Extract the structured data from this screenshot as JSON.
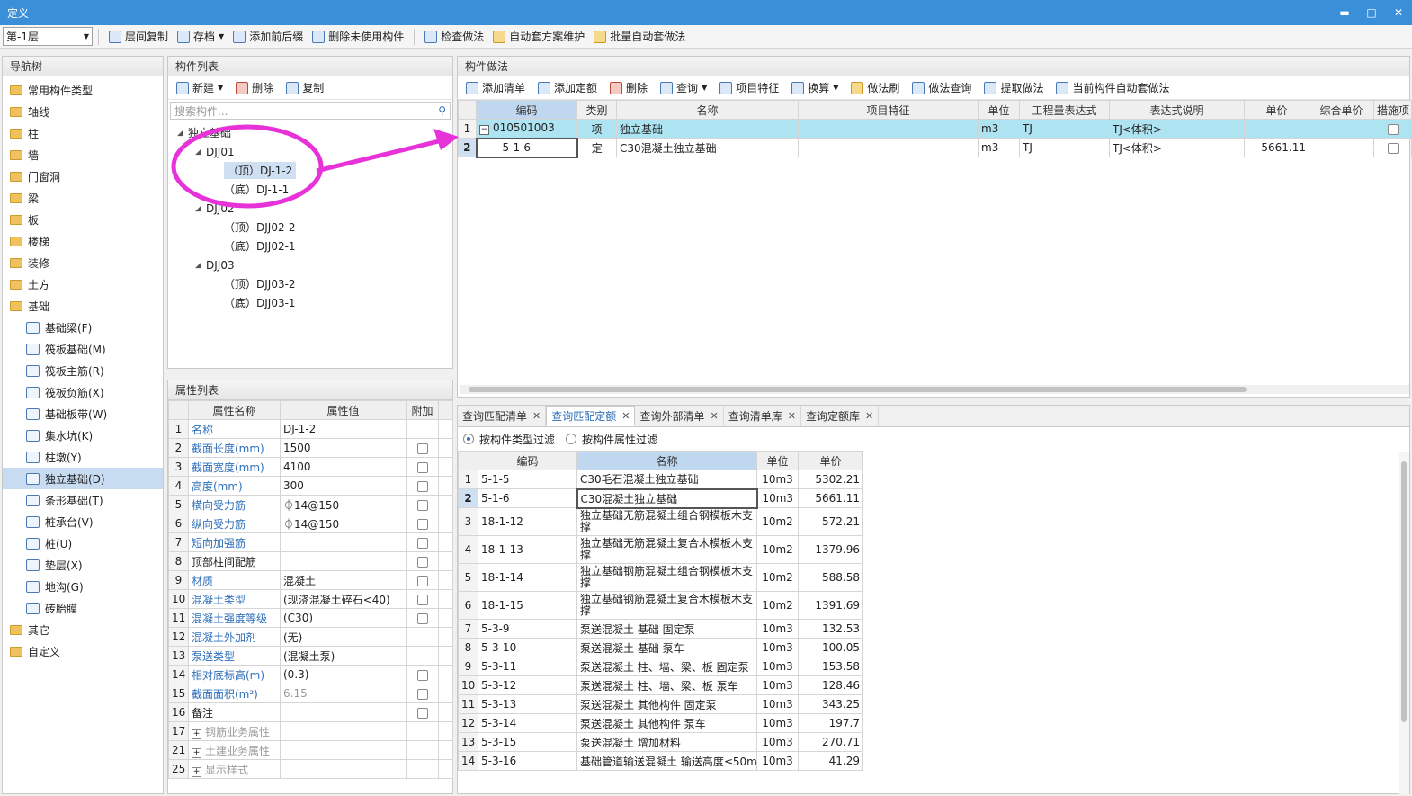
{
  "window": {
    "title": "定义",
    "minimize": "▬",
    "maximize": "□",
    "close": "✕"
  },
  "toolbar": {
    "floor": "第-1层",
    "buttons": [
      "层间复制",
      "存档",
      "添加前后缀",
      "删除未使用构件",
      "检查做法",
      "自动套方案维护",
      "批量自动套做法"
    ]
  },
  "nav": {
    "title": "导航树",
    "top_items": [
      "常用构件类型",
      "轴线",
      "柱",
      "墙",
      "门窗洞",
      "梁",
      "板",
      "楼梯",
      "装修",
      "土方",
      "基础"
    ],
    "sub_items": [
      "基础梁(F)",
      "筏板基础(M)",
      "筏板主筋(R)",
      "筏板负筋(X)",
      "基础板带(W)",
      "集水坑(K)",
      "柱墩(Y)",
      "独立基础(D)",
      "条形基础(T)",
      "桩承台(V)",
      "桩(U)",
      "垫层(X)",
      "地沟(G)",
      "砖胎膜"
    ],
    "bottom_items": [
      "其它",
      "自定义"
    ]
  },
  "component_list": {
    "title": "构件列表",
    "new": "新建",
    "delete": "删除",
    "copy": "复制",
    "search_placeholder": "搜索构件...",
    "tree": {
      "root": "独立基础",
      "groups": [
        {
          "name": "DJJ01",
          "children": [
            "（顶）DJ-1-2",
            "（底）DJ-1-1"
          ]
        },
        {
          "name": "DJJ02",
          "children": [
            "（顶）DJJ02-2",
            "（底）DJJ02-1"
          ]
        },
        {
          "name": "DJJ03",
          "children": [
            "（顶）DJJ03-2",
            "（底）DJJ03-1"
          ]
        }
      ]
    }
  },
  "properties": {
    "title": "属性列表",
    "headers": [
      "属性名称",
      "属性值",
      "附加"
    ],
    "rows": [
      {
        "n": "1",
        "name": "名称",
        "value": "DJ-1-2",
        "cb": false
      },
      {
        "n": "2",
        "name": "截面长度(mm)",
        "value": "1500",
        "cb": true
      },
      {
        "n": "3",
        "name": "截面宽度(mm)",
        "value": "4100",
        "cb": true
      },
      {
        "n": "4",
        "name": "高度(mm)",
        "value": "300",
        "cb": true
      },
      {
        "n": "5",
        "name": "横向受力筋",
        "value": "⏀14@150",
        "cb": true
      },
      {
        "n": "6",
        "name": "纵向受力筋",
        "value": "⏀14@150",
        "cb": true
      },
      {
        "n": "7",
        "name": "短向加强筋",
        "value": "",
        "cb": true
      },
      {
        "n": "8",
        "name": "顶部柱间配筋",
        "value": "",
        "cb": true
      },
      {
        "n": "9",
        "name": "材质",
        "value": "混凝土",
        "cb": true
      },
      {
        "n": "10",
        "name": "混凝土类型",
        "value": "(现浇混凝土碎石<40)",
        "cb": true
      },
      {
        "n": "11",
        "name": "混凝土强度等级",
        "value": "(C30)",
        "cb": true
      },
      {
        "n": "12",
        "name": "混凝土外加剂",
        "value": "(无)",
        "cb": false
      },
      {
        "n": "13",
        "name": "泵送类型",
        "value": "(混凝土泵)",
        "cb": false
      },
      {
        "n": "14",
        "name": "相对底标高(m)",
        "value": "(0.3)",
        "cb": true
      },
      {
        "n": "15",
        "name": "截面面积(m²)",
        "value": "6.15",
        "cb": true
      },
      {
        "n": "16",
        "name": "备注",
        "value": "",
        "cb": true
      },
      {
        "n": "17",
        "name": "钢筋业务属性",
        "value": "",
        "cb": false
      },
      {
        "n": "21",
        "name": "土建业务属性",
        "value": "",
        "cb": false
      },
      {
        "n": "25",
        "name": "显示样式",
        "value": "",
        "cb": false
      }
    ]
  },
  "methods": {
    "title": "构件做法",
    "buttons": [
      "添加清单",
      "添加定额",
      "删除",
      "查询",
      "项目特征",
      "换算",
      "做法刷",
      "做法查询",
      "提取做法",
      "当前构件自动套做法"
    ],
    "headers": [
      "编码",
      "类别",
      "名称",
      "项目特征",
      "单位",
      "工程量表达式",
      "表达式说明",
      "单价",
      "综合单价",
      "措施项"
    ],
    "rows": [
      {
        "n": "1",
        "code": "010501003",
        "type": "项",
        "name": "独立基础",
        "feature": "",
        "unit": "m3",
        "expr": "TJ",
        "desc": "TJ<体积>",
        "price": "",
        "total": ""
      },
      {
        "n": "2",
        "code": "5-1-6",
        "type": "定",
        "name": "C30混凝土独立基础",
        "feature": "",
        "unit": "m3",
        "expr": "TJ",
        "desc": "TJ<体积>",
        "price": "5661.11",
        "total": ""
      }
    ]
  },
  "query": {
    "tabs": [
      "查询匹配清单",
      "查询匹配定额",
      "查询外部清单",
      "查询清单库",
      "查询定额库"
    ],
    "filter_type": "按构件类型过滤",
    "filter_attr": "按构件属性过滤",
    "headers": [
      "编码",
      "名称",
      "单位",
      "单价"
    ],
    "rows": [
      {
        "n": "1",
        "code": "5-1-5",
        "name": "C30毛石混凝土独立基础",
        "unit": "10m3",
        "price": "5302.21"
      },
      {
        "n": "2",
        "code": "5-1-6",
        "name": "C30混凝土独立基础",
        "unit": "10m3",
        "price": "5661.11"
      },
      {
        "n": "3",
        "code": "18-1-12",
        "name": "独立基础无筋混凝土组合钢模板木支撑",
        "unit": "10m2",
        "price": "572.21"
      },
      {
        "n": "4",
        "code": "18-1-13",
        "name": "独立基础无筋混凝土复合木模板木支撑",
        "unit": "10m2",
        "price": "1379.96"
      },
      {
        "n": "5",
        "code": "18-1-14",
        "name": "独立基础钢筋混凝土组合钢模板木支撑",
        "unit": "10m2",
        "price": "588.58"
      },
      {
        "n": "6",
        "code": "18-1-15",
        "name": "独立基础钢筋混凝土复合木模板木支撑",
        "unit": "10m2",
        "price": "1391.69"
      },
      {
        "n": "7",
        "code": "5-3-9",
        "name": "泵送混凝土 基础 固定泵",
        "unit": "10m3",
        "price": "132.53"
      },
      {
        "n": "8",
        "code": "5-3-10",
        "name": "泵送混凝土 基础 泵车",
        "unit": "10m3",
        "price": "100.05"
      },
      {
        "n": "9",
        "code": "5-3-11",
        "name": "泵送混凝土 柱、墙、梁、板 固定泵",
        "unit": "10m3",
        "price": "153.58"
      },
      {
        "n": "10",
        "code": "5-3-12",
        "name": "泵送混凝土 柱、墙、梁、板 泵车",
        "unit": "10m3",
        "price": "128.46"
      },
      {
        "n": "11",
        "code": "5-3-13",
        "name": "泵送混凝土 其他构件 固定泵",
        "unit": "10m3",
        "price": "343.25"
      },
      {
        "n": "12",
        "code": "5-3-14",
        "name": "泵送混凝土 其他构件 泵车",
        "unit": "10m3",
        "price": "197.7"
      },
      {
        "n": "13",
        "code": "5-3-15",
        "name": "泵送混凝土 增加材料",
        "unit": "10m3",
        "price": "270.71"
      },
      {
        "n": "14",
        "code": "5-3-16",
        "name": "基础管道输送混凝土 输送高度≤50m",
        "unit": "10m3",
        "price": "41.29"
      }
    ]
  },
  "annotation": {
    "color": "#e632d8"
  }
}
